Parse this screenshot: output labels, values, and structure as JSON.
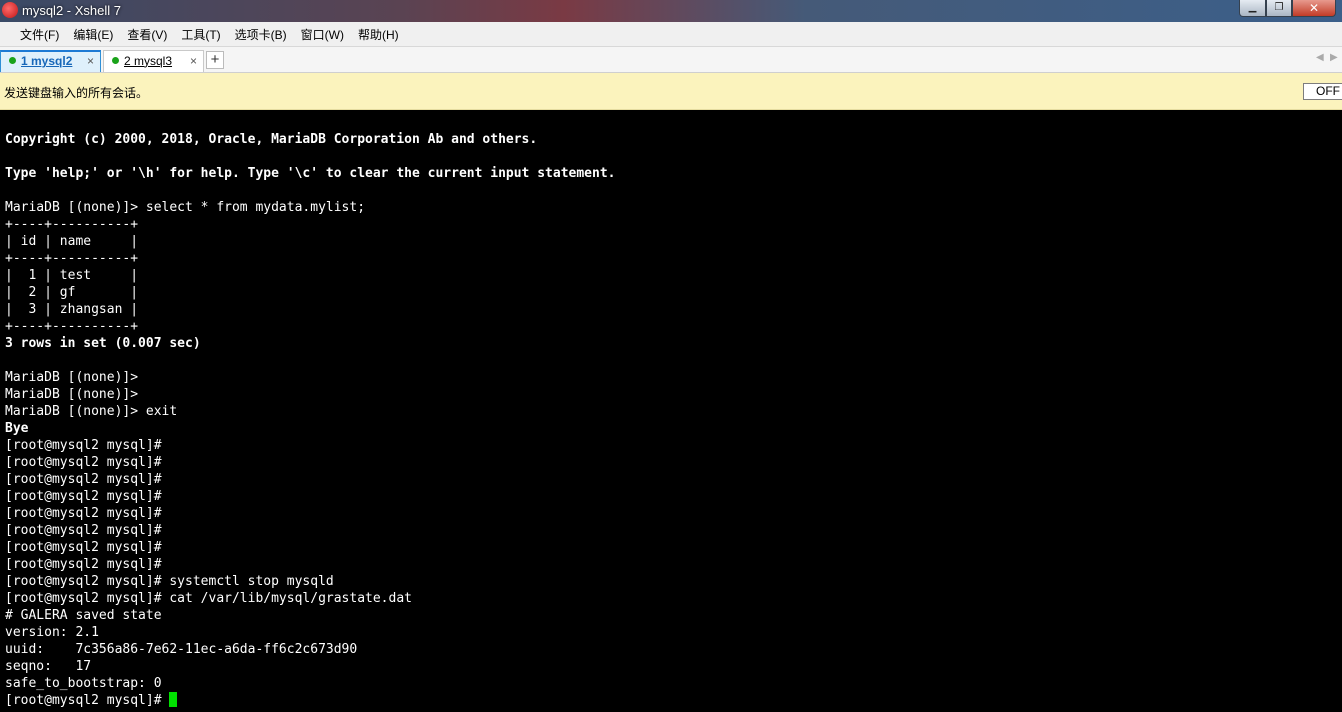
{
  "window": {
    "title": "mysql2 - Xshell 7",
    "controls": {
      "minimize": "▁",
      "maximize": "❐",
      "close": "✕"
    }
  },
  "menu": [
    "文件(F)",
    "编辑(E)",
    "查看(V)",
    "工具(T)",
    "选项卡(B)",
    "窗口(W)",
    "帮助(H)"
  ],
  "tabs": [
    {
      "label": "1 mysql2",
      "active": true,
      "status_color": "#1aa31a",
      "close": "×"
    },
    {
      "label": "2 mysql3",
      "active": false,
      "status_color": "#1aa31a",
      "close": "×"
    }
  ],
  "tab_add": "+",
  "tab_nav": {
    "prev": "◀",
    "next": "▶"
  },
  "send_bar": {
    "text": "发送键盘输入的所有会话。",
    "toggle": "OFF"
  },
  "terminal": {
    "lines": [
      {
        "text": "Copyright (c) 2000, 2018, Oracle, MariaDB Corporation Ab and others.",
        "bold": true
      },
      {
        "text": "",
        "bold": false
      },
      {
        "text": "Type 'help;' or '\\h' for help. Type '\\c' to clear the current input statement.",
        "bold": true
      },
      {
        "text": "",
        "bold": false
      },
      {
        "text": "MariaDB [(none)]> select * from mydata.mylist;",
        "bold": false
      },
      {
        "text": "+----+----------+",
        "bold": false
      },
      {
        "text": "| id | name     |",
        "bold": false
      },
      {
        "text": "+----+----------+",
        "bold": false
      },
      {
        "text": "|  1 | test     |",
        "bold": false
      },
      {
        "text": "|  2 | gf       |",
        "bold": false
      },
      {
        "text": "|  3 | zhangsan |",
        "bold": false
      },
      {
        "text": "+----+----------+",
        "bold": false
      },
      {
        "text": "3 rows in set (0.007 sec)",
        "bold": true
      },
      {
        "text": "",
        "bold": false
      },
      {
        "text": "MariaDB [(none)]>",
        "bold": false
      },
      {
        "text": "MariaDB [(none)]>",
        "bold": false
      },
      {
        "text": "MariaDB [(none)]> exit",
        "bold": false
      },
      {
        "text": "Bye",
        "bold": true
      },
      {
        "text": "[root@mysql2 mysql]#",
        "bold": false
      },
      {
        "text": "[root@mysql2 mysql]#",
        "bold": false
      },
      {
        "text": "[root@mysql2 mysql]#",
        "bold": false
      },
      {
        "text": "[root@mysql2 mysql]#",
        "bold": false
      },
      {
        "text": "[root@mysql2 mysql]#",
        "bold": false
      },
      {
        "text": "[root@mysql2 mysql]#",
        "bold": false
      },
      {
        "text": "[root@mysql2 mysql]#",
        "bold": false
      },
      {
        "text": "[root@mysql2 mysql]#",
        "bold": false
      },
      {
        "text": "[root@mysql2 mysql]# systemctl stop mysqld",
        "bold": false
      },
      {
        "text": "[root@mysql2 mysql]# cat /var/lib/mysql/grastate.dat",
        "bold": false
      },
      {
        "text": "# GALERA saved state",
        "bold": false
      },
      {
        "text": "version: 2.1",
        "bold": false
      },
      {
        "text": "uuid:    7c356a86-7e62-11ec-a6da-ff6c2c673d90",
        "bold": false
      },
      {
        "text": "seqno:   17",
        "bold": false
      },
      {
        "text": "safe_to_bootstrap: 0",
        "bold": false
      }
    ],
    "prompt": "[root@mysql2 mysql]# ",
    "cursor_color": "#00e000"
  }
}
